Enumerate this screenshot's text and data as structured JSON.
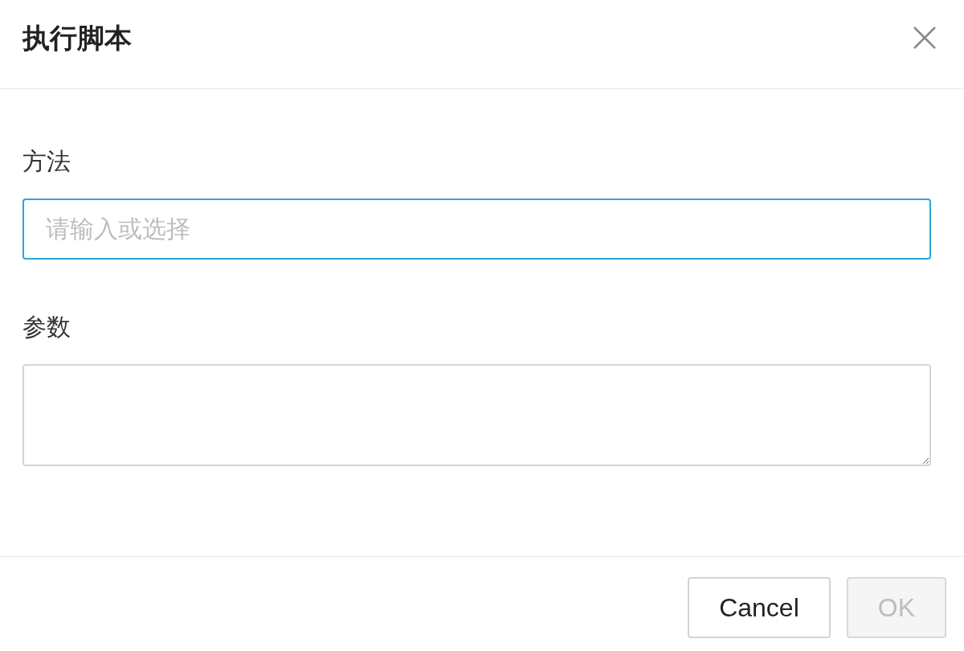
{
  "dialog": {
    "title": "执行脚本"
  },
  "fields": [
    {
      "kind": "input",
      "label": "方法",
      "placeholder": "请输入或选择",
      "focused": true
    },
    {
      "kind": "textarea",
      "label": "参数",
      "focused": false
    }
  ],
  "buttons": [
    {
      "label": "Cancel",
      "disabled": false
    },
    {
      "label": "OK",
      "disabled": true
    }
  ]
}
